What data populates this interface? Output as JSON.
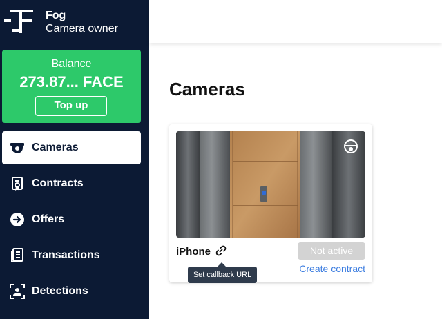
{
  "brand": {
    "name": "Fog",
    "role": "Camera owner"
  },
  "balance": {
    "label": "Balance",
    "value": "273.87... FACE",
    "topup_label": "Top up"
  },
  "nav": {
    "items": [
      {
        "label": "Cameras",
        "icon": "camera-icon",
        "active": true
      },
      {
        "label": "Contracts",
        "icon": "contract-icon"
      },
      {
        "label": "Offers",
        "icon": "arrow-circle-icon"
      },
      {
        "label": "Transactions",
        "icon": "list-icon"
      },
      {
        "label": "Detections",
        "icon": "face-scan-icon"
      }
    ]
  },
  "main": {
    "title": "Cameras"
  },
  "cameras": [
    {
      "name": "iPhone",
      "status": "Not active",
      "action_label": "Create contract",
      "tooltip": "Set callback URL",
      "badge_icon": "face-mask-icon"
    }
  ],
  "colors": {
    "sidebar_bg": "#0c1a34",
    "balance_bg": "#2dc96a",
    "link": "#3c7de0",
    "status_bg": "#d3d3d3",
    "tooltip_bg": "#2f3b4c"
  }
}
